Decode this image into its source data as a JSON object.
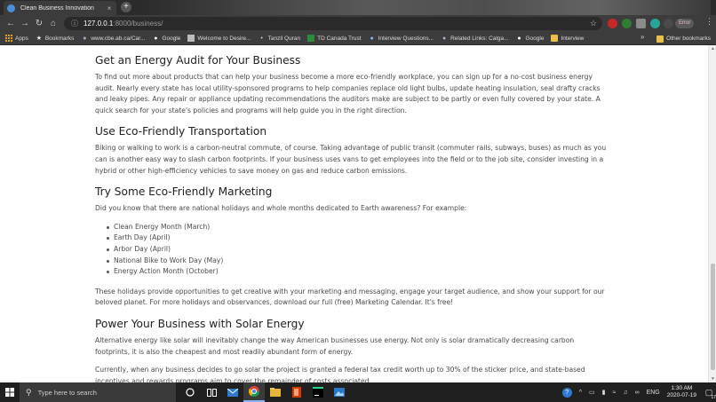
{
  "browser": {
    "tab_title": "Clean Business Innovation",
    "tab_close": "×",
    "new_tab": "+",
    "url_host": "127.0.0.1",
    "url_path": ":8000/business/",
    "error_badge": "Error",
    "bookmarks": [
      {
        "label": "Apps",
        "icon": "apps-grid-icon"
      },
      {
        "label": "Bookmarks",
        "icon": "star-icon"
      },
      {
        "label": "www.cbe.ab.ca/Car...",
        "icon": "globe-icon"
      },
      {
        "label": "Google",
        "icon": "google-icon"
      },
      {
        "label": "Welcome to Desire...",
        "icon": "site-icon"
      },
      {
        "label": "Tanzil Quran",
        "icon": "tanzil-icon"
      },
      {
        "label": "TD Canada Trust",
        "icon": "td-icon"
      },
      {
        "label": "Interview Questions...",
        "icon": "web-icon"
      },
      {
        "label": "Related Links: Calga...",
        "icon": "globe-icon"
      },
      {
        "label": "Google",
        "icon": "google-icon"
      },
      {
        "label": "Interview",
        "icon": "folder-icon"
      }
    ],
    "other_bookmarks": "Other bookmarks"
  },
  "article": {
    "sections": [
      {
        "heading": "Get an Energy Audit for Your Business",
        "paragraphs": [
          "To find out more about products that can help your business become a more eco-friendly workplace, you can sign up for a no-cost business energy audit. Nearly every state has local utility-sponsored programs to help companies replace old light bulbs, update heating insulation, seal drafty cracks and leaky pipes. Any repair or appliance updating recommendations the auditors make are subject to be partly or even fully covered by your state. A quick search for your state's policies and programs will help guide you in the right direction."
        ]
      },
      {
        "heading": "Use Eco-Friendly Transportation",
        "paragraphs": [
          "Biking or walking to work is a carbon-neutral commute, of course. Taking advantage of public transit (commuter rails, subways, buses) as much as you can is another easy way to slash carbon footprints. If your business uses vans to get employees into the field or to the job site, consider investing in a hybrid or other high-efficiency vehicles to save money on gas and reduce carbon emissions."
        ]
      },
      {
        "heading": "Try Some Eco-Friendly Marketing",
        "intro": "Did you know that there are national holidays and whole months dedicated to Earth awareness? For example:",
        "list": [
          "Clean Energy Month (March)",
          "Earth Day (April)",
          "Arbor Day (April)",
          "National Bike to Work Day (May)",
          "Energy Action Month (October)"
        ],
        "outro": "These holidays provide opportunities to get creative with your marketing and messaging, engage your target audience, and show your support for our beloved planet. For more holidays and observances, download our full (free) Marketing Calendar. It's free!"
      },
      {
        "heading": "Power Your Business with Solar Energy",
        "paragraphs": [
          "Alternative energy like solar will inevitably change the way American businesses use energy. Not only is solar dramatically decreasing carbon footprints, it is also the cheapest and most readily abundant form of energy.",
          "Currently, when any business decides to go solar the project is granted a federal tax credit worth up to 30% of the sticker price, and state-based incentives and rewards programs aim to cover the remainder of costs associated."
        ]
      }
    ]
  },
  "taskbar": {
    "search_placeholder": "Type here to search",
    "language": "ENG",
    "time": "1:30 AM",
    "date": "2020-07-19",
    "notification_count": "17"
  },
  "colors": {
    "browser_chrome": "#3c3c3c",
    "taskbar": "#202020",
    "accent": "#8ab4f8"
  }
}
